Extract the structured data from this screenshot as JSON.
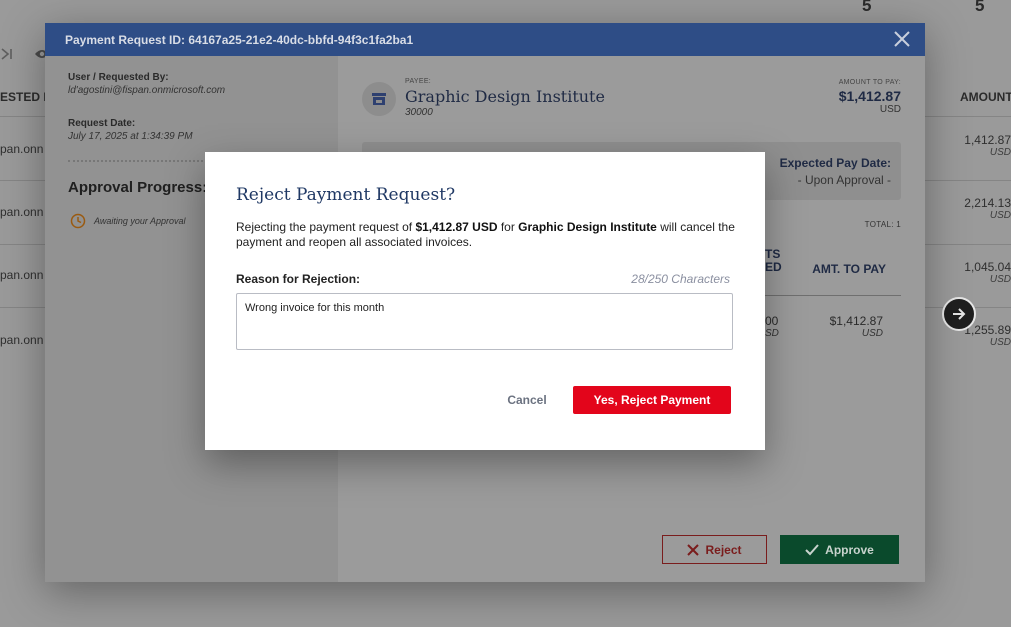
{
  "background": {
    "top_numbers": [
      "5",
      "5"
    ],
    "left_header": "ESTED B",
    "left_cells": [
      "pan.onn",
      "pan.onn",
      "pan.onn",
      "pan.onn"
    ],
    "right_header": "AMOUNT",
    "amounts": [
      {
        "value": "1,412.87",
        "currency": "USD"
      },
      {
        "value": "2,214.13",
        "currency": "USD"
      },
      {
        "value": "1,045.04",
        "currency": "USD"
      },
      {
        "value": "1,255.89",
        "currency": "USD"
      }
    ]
  },
  "panel": {
    "header_title": "Payment Request ID: 64167a25-21e2-40dc-bbfd-94f3c1fa2ba1",
    "user_label": "User / Requested By:",
    "user_value": "ld'agostini@fispan.onmicrosoft.com",
    "date_label": "Request Date:",
    "date_value": "July 17, 2025 at 1:34:39 PM",
    "approval_title": "Approval Progress:",
    "approval_status": "Awaiting your Approval",
    "payee_label": "PAYEE:",
    "payee_name": "Graphic Design Institute",
    "payee_number": "30000",
    "amount_label": "AMOUNT TO PAY:",
    "amount_value": "$1,412.87",
    "amount_currency": "USD",
    "pay_date_label": "Expected Pay Date:",
    "pay_date_value": "- Upon Approval -",
    "total_label": "TOTAL: 1",
    "col_partial_line1": "TS",
    "col_partial_line2": "ED",
    "col_amt_to_pay": "AMT. TO PAY",
    "row_partial_value": "00",
    "row_partial_currency": "SD",
    "row_amount": "$1,412.87",
    "row_currency": "USD",
    "reject_label": "Reject",
    "approve_label": "Approve"
  },
  "modal": {
    "title": "Reject Payment Request?",
    "desc_pre": "Rejecting the payment request of ",
    "desc_amount": "$1,412.87 USD",
    "desc_mid": " for ",
    "desc_payee": "Graphic Design Institute",
    "desc_post": " will cancel the payment and reopen all associated invoices.",
    "reason_label": "Reason for Rejection:",
    "char_count": "28/250 Characters",
    "reason_value": "Wrong invoice for this month",
    "cancel_label": "Cancel",
    "confirm_label": "Yes, Reject Payment"
  },
  "colors": {
    "header_blue": "#2e4d86",
    "title_navy": "#1f3864",
    "reject_red": "#e3051b",
    "approve_green": "#0a4a2c"
  }
}
